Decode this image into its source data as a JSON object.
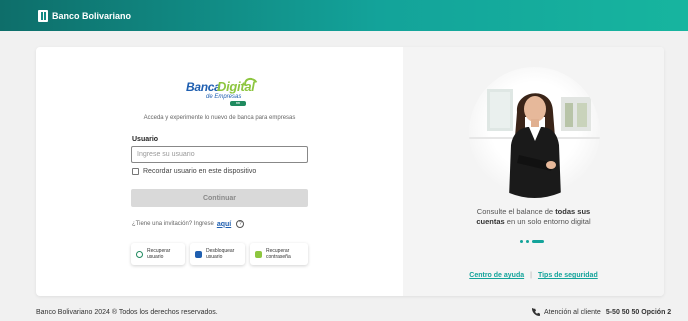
{
  "header": {
    "brand": "Banco Bolivariano"
  },
  "logo": {
    "word1": "Banca",
    "word2": "Digital",
    "sub": "de Empresas",
    "tag": "BB"
  },
  "login": {
    "intro": "Acceda y experimente lo nuevo de banca para empresas",
    "user_label": "Usuario",
    "user_placeholder": "Ingrese su usuario",
    "remember_label": "Recordar usuario en este dispositivo",
    "continue_label": "Continuar",
    "invite_text": "¿Tiene una invitación? Ingrese",
    "invite_link": "aquí",
    "help_icon_glyph": "?"
  },
  "quick_actions": [
    {
      "line1": "Recuperar",
      "line2": "usuario",
      "icon": "user-search-icon"
    },
    {
      "line1": "Desbloquear",
      "line2": "usuario",
      "icon": "unlock-icon"
    },
    {
      "line1": "Recuperar",
      "line2": "contraseña",
      "icon": "key-icon"
    }
  ],
  "promo": {
    "caption_pre": "Consulte el balance de ",
    "caption_bold1": "todas sus",
    "caption_bold2": "cuentas",
    "caption_post": " en un solo entorno digital",
    "slides": 3,
    "active_slide": 3
  },
  "links": {
    "help_center": "Centro de ayuda",
    "security_tips": "Tips de seguridad",
    "separator": "|"
  },
  "footer": {
    "copyright": "Banco Bolivariano 2024 ® Todos los derechos reservados.",
    "support_label": "Atención al cliente",
    "support_number": "5-50 50 50 Opción 2"
  },
  "colors": {
    "brand_teal": "#13a39a",
    "brand_blue": "#1f5fb0",
    "brand_green": "#8dc63f"
  }
}
